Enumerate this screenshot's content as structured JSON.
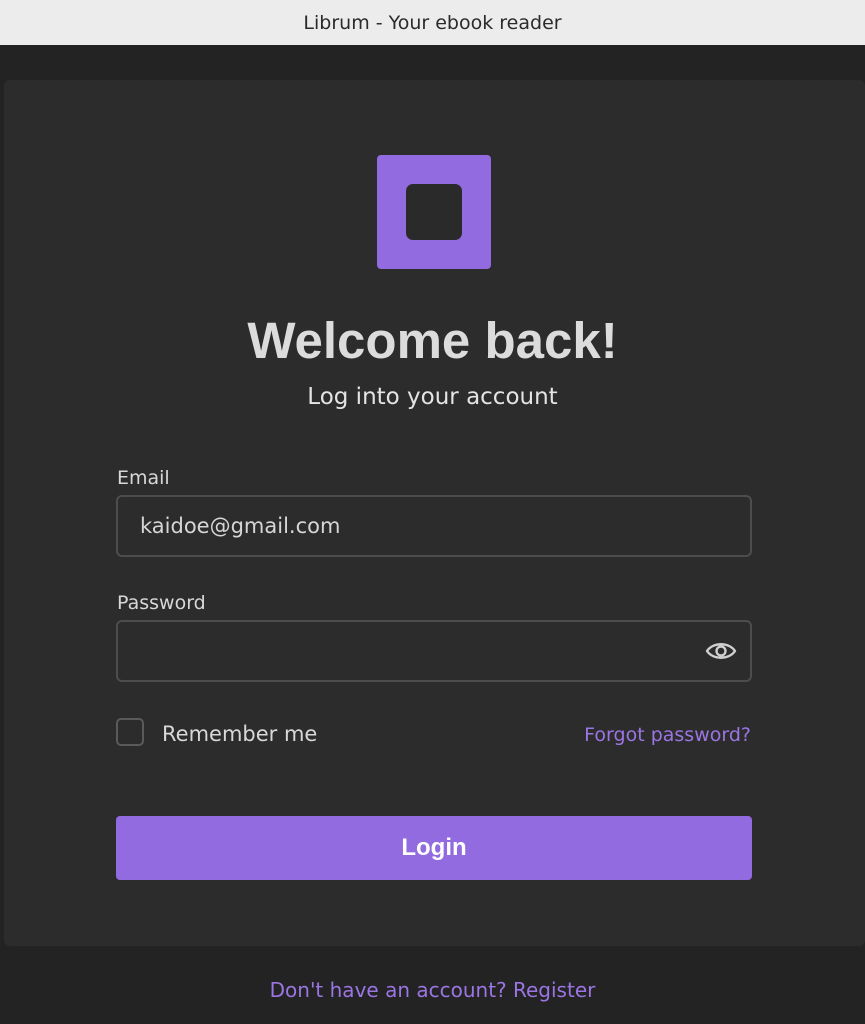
{
  "window": {
    "title": "Librum - Your ebook reader"
  },
  "login": {
    "logo_icon": "app-logo-icon",
    "heading": "Welcome back!",
    "subheading": "Log into your account",
    "email": {
      "label": "Email",
      "value": "kaidoe@gmail.com"
    },
    "password": {
      "label": "Password",
      "value": "",
      "toggle_icon": "eye-icon"
    },
    "remember_me": {
      "label": "Remember me",
      "checked": false
    },
    "forgot_password": "Forgot password?",
    "login_button": "Login",
    "register_link": "Don't have an account? Register"
  },
  "colors": {
    "accent": "#926be0",
    "link": "#9b75e3",
    "background": "#232323",
    "card": "#2c2c2c"
  }
}
